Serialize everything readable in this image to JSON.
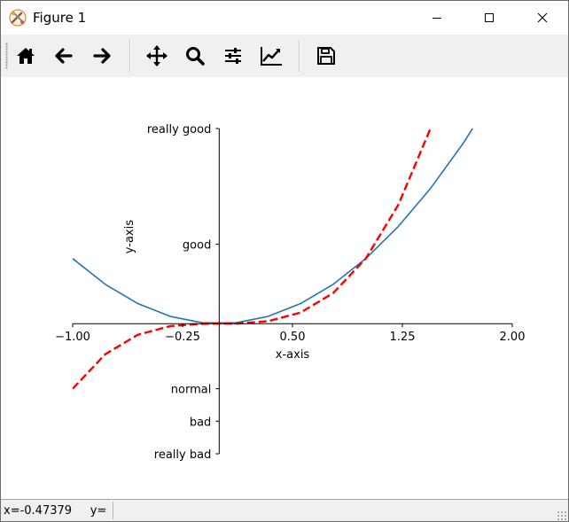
{
  "window": {
    "title": "Figure 1",
    "icon": "matplotlib-tools-icon"
  },
  "window_controls": {
    "minimize_icon": "minimize-icon",
    "maximize_icon": "maximize-icon",
    "close_icon": "close-icon"
  },
  "toolbar": {
    "tools": [
      {
        "name": "home",
        "icon": "home-icon"
      },
      {
        "name": "back",
        "icon": "arrow-left-icon"
      },
      {
        "name": "forward",
        "icon": "arrow-right-icon"
      },
      {
        "name": "pan",
        "icon": "move-icon"
      },
      {
        "name": "zoom",
        "icon": "magnifier-icon"
      },
      {
        "name": "configure-subplots",
        "icon": "sliders-icon"
      },
      {
        "name": "edit-axes",
        "icon": "line-chart-icon"
      },
      {
        "name": "save",
        "icon": "floppy-disk-icon"
      }
    ]
  },
  "chart_data": {
    "type": "line",
    "title": "",
    "xlabel": "x-axis",
    "ylabel": "y-axis",
    "xlim": [
      -1.0,
      2.0
    ],
    "ylim": [
      -2.0,
      3.0
    ],
    "spines": "centered at origin",
    "xticks": [
      {
        "value": -1.0,
        "label": "−1.00"
      },
      {
        "value": -0.25,
        "label": "−0.25"
      },
      {
        "value": 0.5,
        "label": "0.50"
      },
      {
        "value": 1.25,
        "label": "1.25"
      },
      {
        "value": 2.0,
        "label": "2.00"
      }
    ],
    "yticks": [
      {
        "value": -2.0,
        "label": "really bad"
      },
      {
        "value": -1.5,
        "label": "bad"
      },
      {
        "value": -1.0,
        "label": "normal"
      },
      {
        "value": 1.22,
        "label": "good"
      },
      {
        "value": 3.0,
        "label": "really good"
      }
    ],
    "series": [
      {
        "color": "#1f77b4",
        "linestyle": "solid",
        "x": [
          -1.0,
          -0.7778,
          -0.5556,
          -0.3333,
          -0.1111,
          0.1111,
          0.3333,
          0.5556,
          0.7778,
          1.0,
          1.2222,
          1.4444,
          1.6667,
          1.8889,
          2.0
        ],
        "y": [
          1.0,
          0.605,
          0.309,
          0.111,
          0.012,
          0.012,
          0.111,
          0.309,
          0.605,
          1.0,
          1.494,
          2.086,
          2.778,
          3.568,
          4.0
        ]
      },
      {
        "color": "#ff0000",
        "linestyle": "dashed",
        "x": [
          -1.0,
          -0.7778,
          -0.5556,
          -0.3333,
          -0.1111,
          0.1111,
          0.3333,
          0.5556,
          0.7778,
          1.0,
          1.2222,
          1.4444,
          1.6667
        ],
        "y": [
          -1.0,
          -0.47,
          -0.171,
          -0.037,
          -0.001,
          0.001,
          0.037,
          0.171,
          0.47,
          1.0,
          1.826,
          3.014,
          4.63
        ]
      }
    ]
  },
  "status": {
    "text": "x=-0.47379     y="
  }
}
